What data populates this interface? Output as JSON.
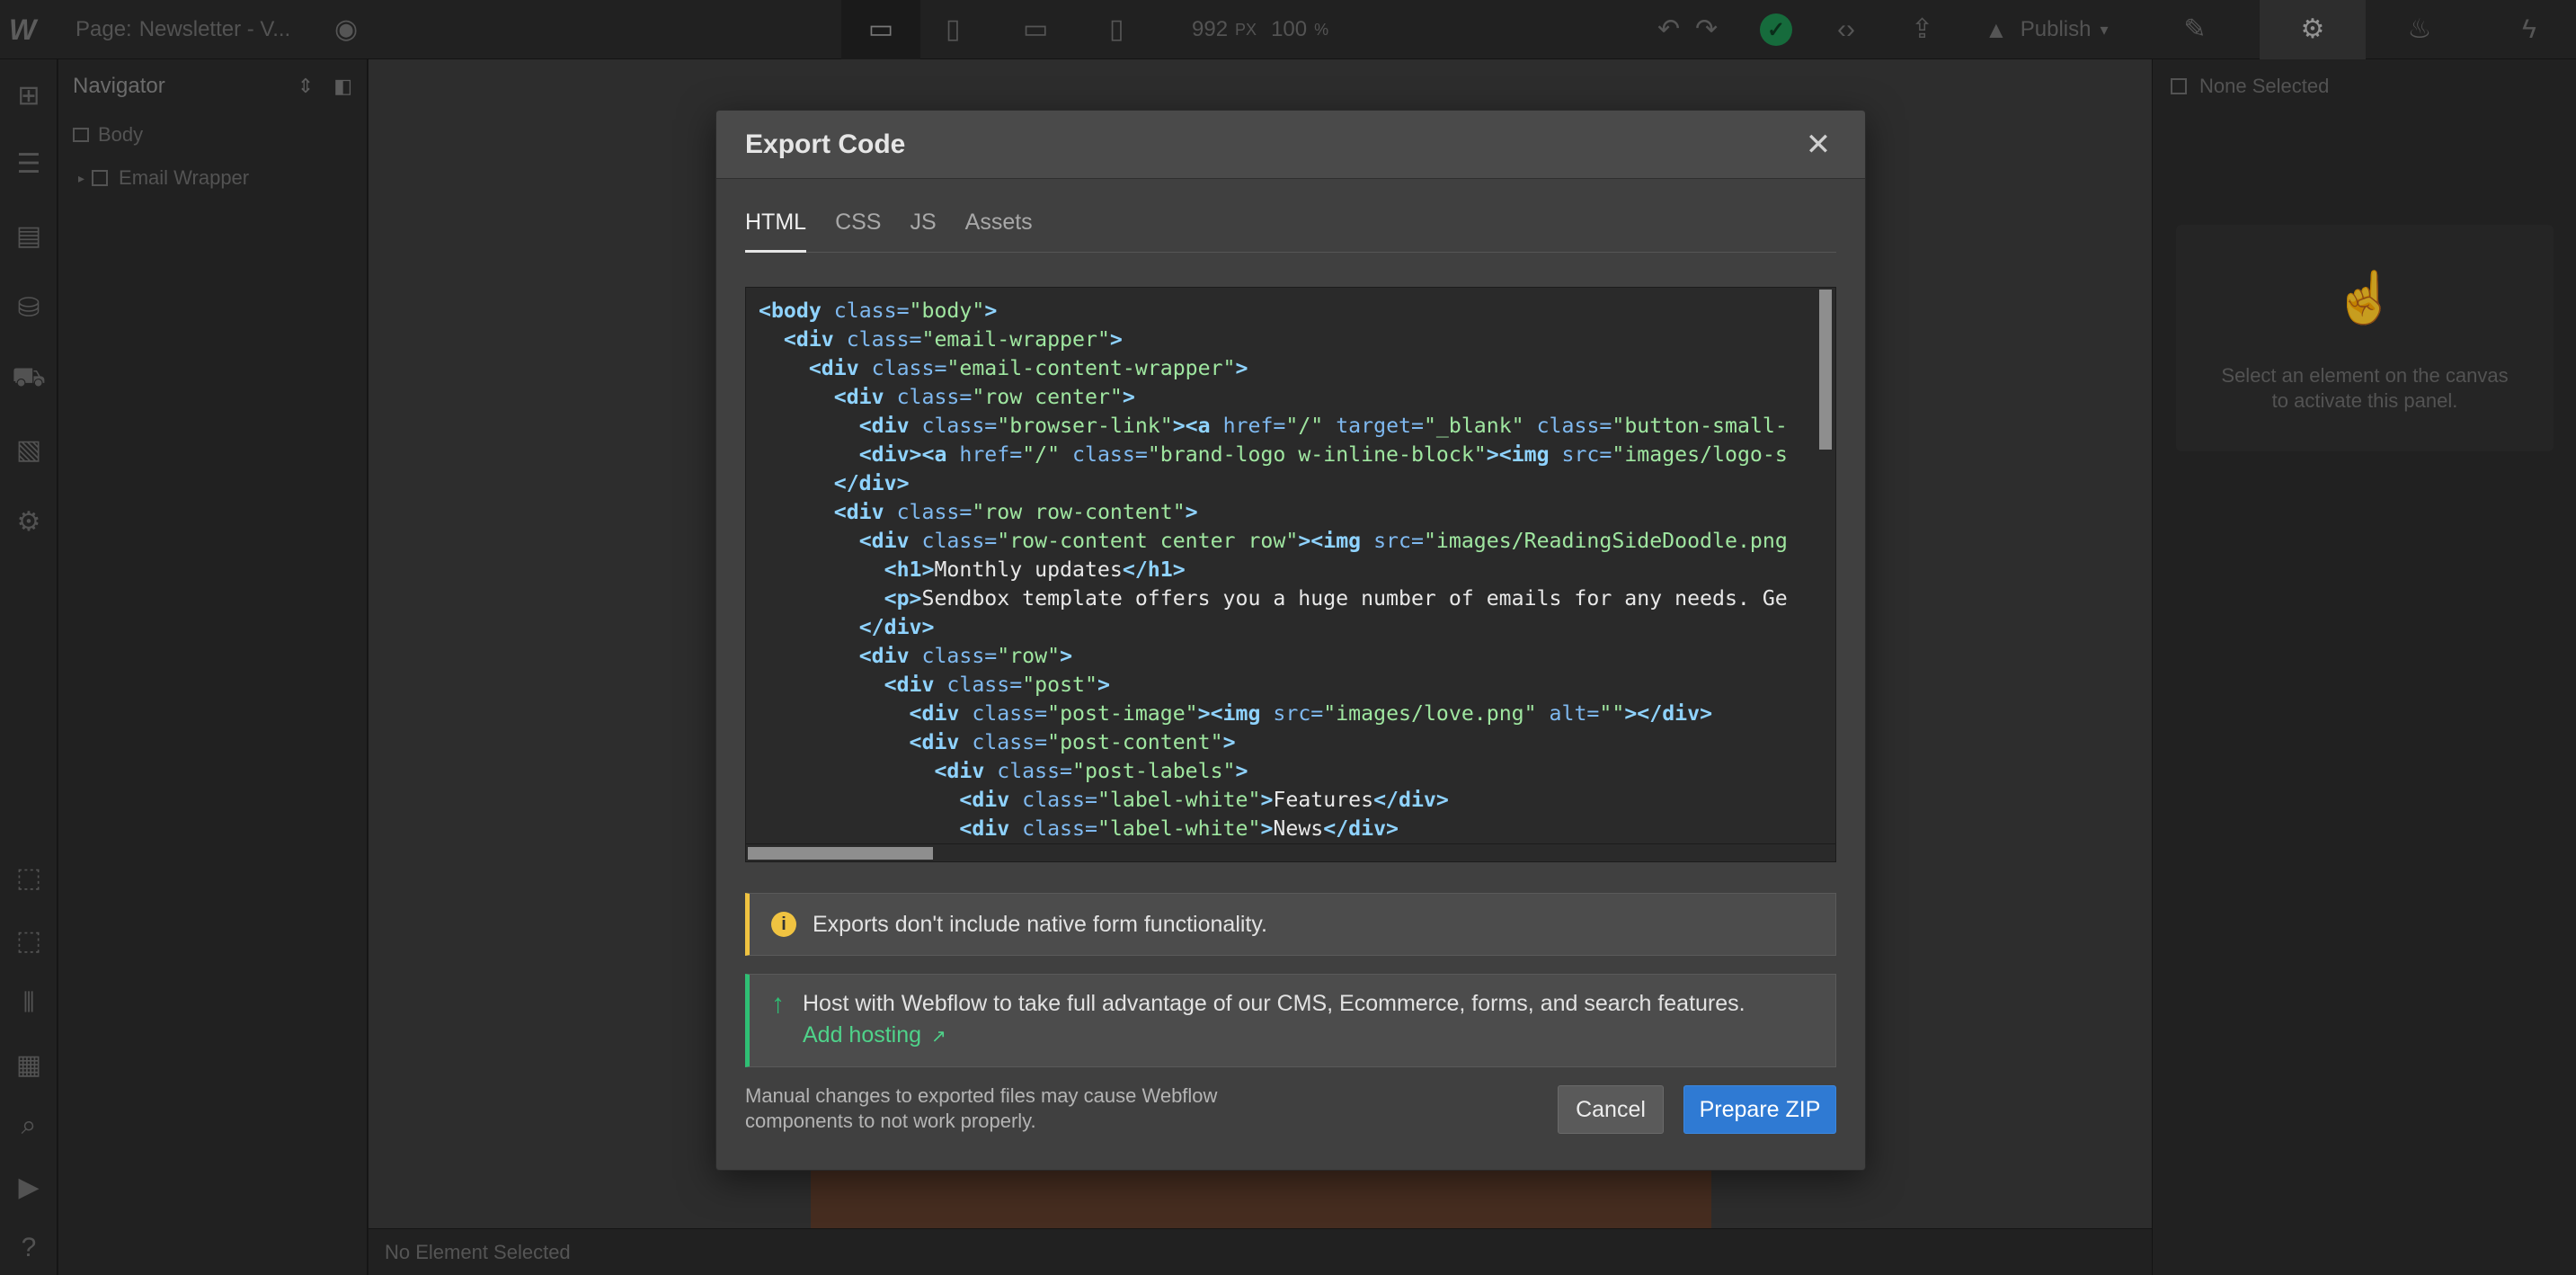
{
  "topbar": {
    "logo": "W",
    "page_label": "Page:",
    "page_name": "Newsletter - V...",
    "width_value": "992",
    "width_unit": "PX",
    "zoom_value": "100",
    "zoom_unit": "%",
    "publish_label": "Publish"
  },
  "navigator": {
    "title": "Navigator",
    "items": [
      {
        "label": "Body"
      },
      {
        "label": "Email Wrapper"
      }
    ]
  },
  "statusbar": {
    "text": "No Element Selected"
  },
  "right_panel": {
    "selection": "None Selected",
    "empty_message": "Select an element on the canvas to activate this panel."
  },
  "modal": {
    "title": "Export Code",
    "tabs": [
      {
        "label": "HTML",
        "active": true
      },
      {
        "label": "CSS",
        "active": false
      },
      {
        "label": "JS",
        "active": false
      },
      {
        "label": "Assets",
        "active": false
      }
    ],
    "code_lines": [
      {
        "indent": 0,
        "tokens": [
          {
            "t": "<",
            "c": "tag"
          },
          {
            "t": "body",
            "c": "tag"
          },
          {
            "t": " class=",
            "c": "attr"
          },
          {
            "t": "\"body\"",
            "c": "val"
          },
          {
            "t": ">",
            "c": "tag"
          }
        ]
      },
      {
        "indent": 1,
        "tokens": [
          {
            "t": "<div",
            "c": "tag"
          },
          {
            "t": " class=",
            "c": "attr"
          },
          {
            "t": "\"email-wrapper\"",
            "c": "val"
          },
          {
            "t": ">",
            "c": "tag"
          }
        ]
      },
      {
        "indent": 2,
        "tokens": [
          {
            "t": "<div",
            "c": "tag"
          },
          {
            "t": " class=",
            "c": "attr"
          },
          {
            "t": "\"email-content-wrapper\"",
            "c": "val"
          },
          {
            "t": ">",
            "c": "tag"
          }
        ]
      },
      {
        "indent": 3,
        "tokens": [
          {
            "t": "<div",
            "c": "tag"
          },
          {
            "t": " class=",
            "c": "attr"
          },
          {
            "t": "\"row center\"",
            "c": "val"
          },
          {
            "t": ">",
            "c": "tag"
          }
        ]
      },
      {
        "indent": 4,
        "tokens": [
          {
            "t": "<div",
            "c": "tag"
          },
          {
            "t": " class=",
            "c": "attr"
          },
          {
            "t": "\"browser-link\"",
            "c": "val"
          },
          {
            "t": "><a",
            "c": "tag"
          },
          {
            "t": " href=",
            "c": "attr"
          },
          {
            "t": "\"/\"",
            "c": "val"
          },
          {
            "t": " target=",
            "c": "attr"
          },
          {
            "t": "\"_blank\"",
            "c": "val"
          },
          {
            "t": " class=",
            "c": "attr"
          },
          {
            "t": "\"button-small-",
            "c": "val"
          }
        ]
      },
      {
        "indent": 4,
        "tokens": [
          {
            "t": "<div><a",
            "c": "tag"
          },
          {
            "t": " href=",
            "c": "attr"
          },
          {
            "t": "\"/\"",
            "c": "val"
          },
          {
            "t": " class=",
            "c": "attr"
          },
          {
            "t": "\"brand-logo w-inline-block\"",
            "c": "val"
          },
          {
            "t": "><img",
            "c": "tag"
          },
          {
            "t": " src=",
            "c": "attr"
          },
          {
            "t": "\"images/logo-s",
            "c": "val"
          }
        ]
      },
      {
        "indent": 3,
        "tokens": [
          {
            "t": "</div>",
            "c": "tag"
          }
        ]
      },
      {
        "indent": 3,
        "tokens": [
          {
            "t": "<div",
            "c": "tag"
          },
          {
            "t": " class=",
            "c": "attr"
          },
          {
            "t": "\"row row-content\"",
            "c": "val"
          },
          {
            "t": ">",
            "c": "tag"
          }
        ]
      },
      {
        "indent": 4,
        "tokens": [
          {
            "t": "<div",
            "c": "tag"
          },
          {
            "t": " class=",
            "c": "attr"
          },
          {
            "t": "\"row-content center row\"",
            "c": "val"
          },
          {
            "t": "><img",
            "c": "tag"
          },
          {
            "t": " src=",
            "c": "attr"
          },
          {
            "t": "\"images/ReadingSideDoodle.png",
            "c": "val"
          }
        ]
      },
      {
        "indent": 5,
        "tokens": [
          {
            "t": "<h1>",
            "c": "tag"
          },
          {
            "t": "Monthly updates",
            "c": "txt"
          },
          {
            "t": "</h1>",
            "c": "tag"
          }
        ]
      },
      {
        "indent": 5,
        "tokens": [
          {
            "t": "<p>",
            "c": "tag"
          },
          {
            "t": "Sendbox template offers you a huge number of emails for any needs. Ge",
            "c": "txt"
          }
        ]
      },
      {
        "indent": 4,
        "tokens": [
          {
            "t": "</div>",
            "c": "tag"
          }
        ]
      },
      {
        "indent": 4,
        "tokens": [
          {
            "t": "<div",
            "c": "tag"
          },
          {
            "t": " class=",
            "c": "attr"
          },
          {
            "t": "\"row\"",
            "c": "val"
          },
          {
            "t": ">",
            "c": "tag"
          }
        ]
      },
      {
        "indent": 5,
        "tokens": [
          {
            "t": "<div",
            "c": "tag"
          },
          {
            "t": " class=",
            "c": "attr"
          },
          {
            "t": "\"post\"",
            "c": "val"
          },
          {
            "t": ">",
            "c": "tag"
          }
        ]
      },
      {
        "indent": 6,
        "tokens": [
          {
            "t": "<div",
            "c": "tag"
          },
          {
            "t": " class=",
            "c": "attr"
          },
          {
            "t": "\"post-image\"",
            "c": "val"
          },
          {
            "t": "><img",
            "c": "tag"
          },
          {
            "t": " src=",
            "c": "attr"
          },
          {
            "t": "\"images/love.png\"",
            "c": "val"
          },
          {
            "t": " alt=",
            "c": "attr"
          },
          {
            "t": "\"\"",
            "c": "val"
          },
          {
            "t": "></div>",
            "c": "tag"
          }
        ]
      },
      {
        "indent": 6,
        "tokens": [
          {
            "t": "<div",
            "c": "tag"
          },
          {
            "t": " class=",
            "c": "attr"
          },
          {
            "t": "\"post-content\"",
            "c": "val"
          },
          {
            "t": ">",
            "c": "tag"
          }
        ]
      },
      {
        "indent": 7,
        "tokens": [
          {
            "t": "<div",
            "c": "tag"
          },
          {
            "t": " class=",
            "c": "attr"
          },
          {
            "t": "\"post-labels\"",
            "c": "val"
          },
          {
            "t": ">",
            "c": "tag"
          }
        ]
      },
      {
        "indent": 8,
        "tokens": [
          {
            "t": "<div",
            "c": "tag"
          },
          {
            "t": " class=",
            "c": "attr"
          },
          {
            "t": "\"label-white\"",
            "c": "val"
          },
          {
            "t": ">",
            "c": "tag"
          },
          {
            "t": "Features",
            "c": "txt"
          },
          {
            "t": "</div>",
            "c": "tag"
          }
        ]
      },
      {
        "indent": 8,
        "tokens": [
          {
            "t": "<div",
            "c": "tag"
          },
          {
            "t": " class=",
            "c": "attr"
          },
          {
            "t": "\"label-white\"",
            "c": "val"
          },
          {
            "t": ">",
            "c": "tag"
          },
          {
            "t": "News",
            "c": "txt"
          },
          {
            "t": "</div>",
            "c": "tag"
          }
        ]
      }
    ],
    "warning_text": "Exports don't include native form functionality.",
    "hosting_text": "Host with Webflow to take full advantage of our CMS, Ecommerce, forms, and search features.",
    "hosting_link": "Add hosting",
    "footer_note": "Manual changes to exported files may cause Webflow components to not work properly.",
    "cancel_label": "Cancel",
    "prepare_label": "Prepare ZIP"
  },
  "colors": {
    "accent_blue": "#2f7ad3",
    "warning_yellow": "#f0c341",
    "success_green": "#2fbf74"
  }
}
